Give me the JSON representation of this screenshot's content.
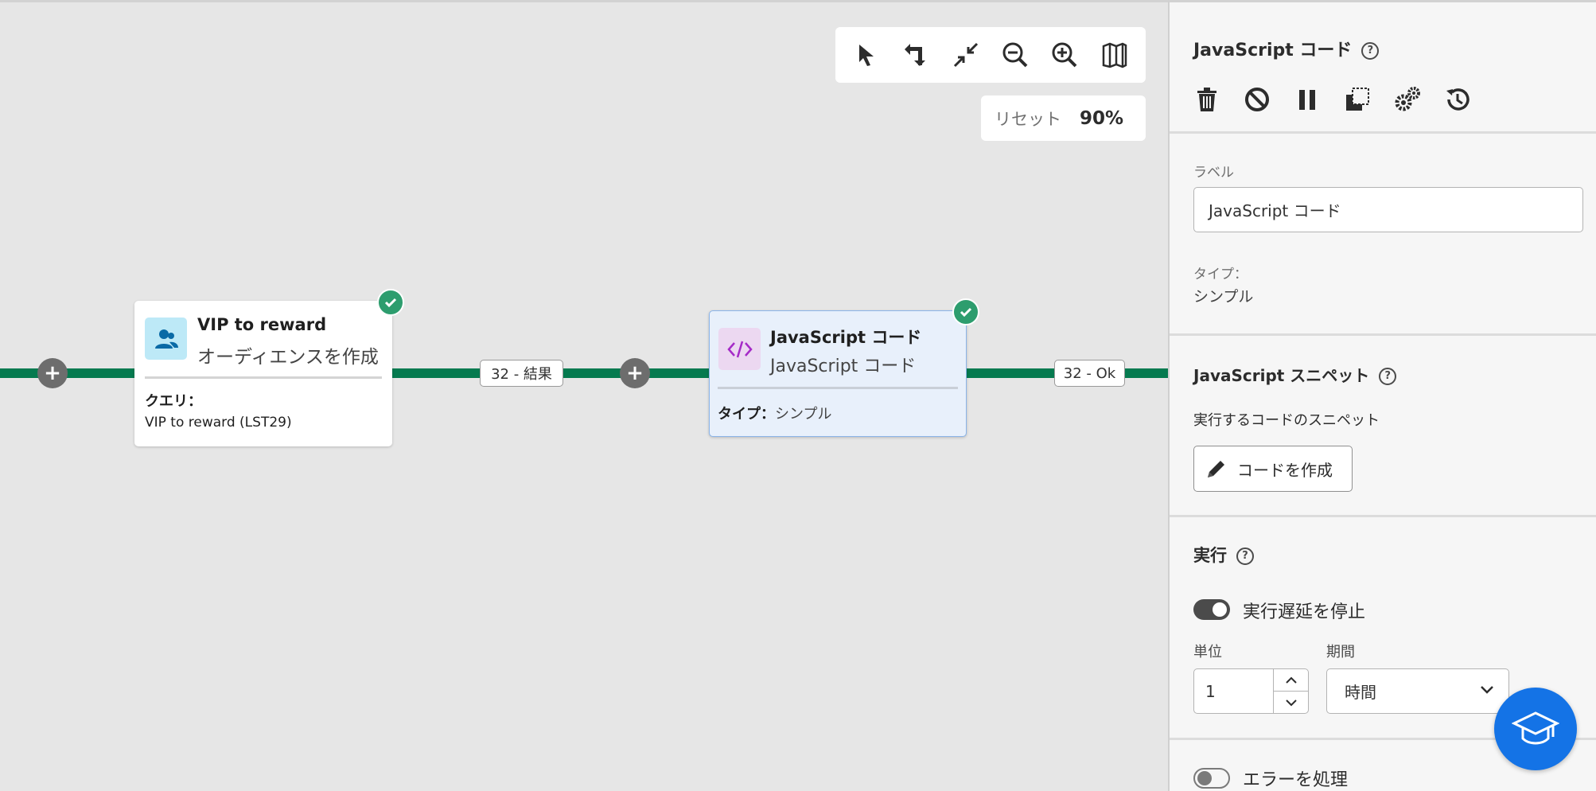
{
  "toolbar": {
    "icons": [
      "pointer-icon",
      "reroute-icon",
      "collapse-icon",
      "zoom-out-icon",
      "zoom-in-icon",
      "map-icon"
    ]
  },
  "zoom": {
    "reset_label": "リセット",
    "value": "90%"
  },
  "workflow": {
    "line_color": "#057a4f",
    "transitions": [
      {
        "label": "32 - 結果"
      },
      {
        "label": "32 - Ok"
      }
    ],
    "nodes": [
      {
        "title": "VIP to reward",
        "subtitle": "オーディエンスを作成",
        "detail_label": "クエリ：",
        "detail_value": "VIP to reward (LST29)",
        "icon": "audience-icon",
        "status": "check-icon"
      },
      {
        "title": "JavaScript コード",
        "subtitle": "JavaScript コード",
        "detail_label": "タイプ：",
        "detail_value": "シンプル",
        "icon": "code-icon",
        "status": "check-icon"
      }
    ]
  },
  "panel": {
    "title": "JavaScript コード",
    "actions": [
      "trash-icon",
      "disable-icon",
      "pause-icon",
      "copy-icon",
      "settings-icon",
      "history-icon"
    ],
    "label_field": {
      "label": "ラベル",
      "value": "JavaScript コード"
    },
    "type_field": {
      "label": "タイプ：",
      "value": "シンプル"
    },
    "snippet": {
      "title": "JavaScript スニペット",
      "description": "実行するコードのスニペット",
      "button": "コードを作成"
    },
    "execution": {
      "title": "実行",
      "toggle_label": "実行遅延を停止",
      "toggle_on": true,
      "unit_label": "単位",
      "unit_value": "1",
      "period_label": "期間",
      "period_value": "時間"
    },
    "error": {
      "toggle_label": "エラーを処理",
      "toggle_on": false
    }
  },
  "colors": {
    "accent": "#1473e6",
    "success": "#2d9d6e",
    "flow": "#057a4f"
  }
}
